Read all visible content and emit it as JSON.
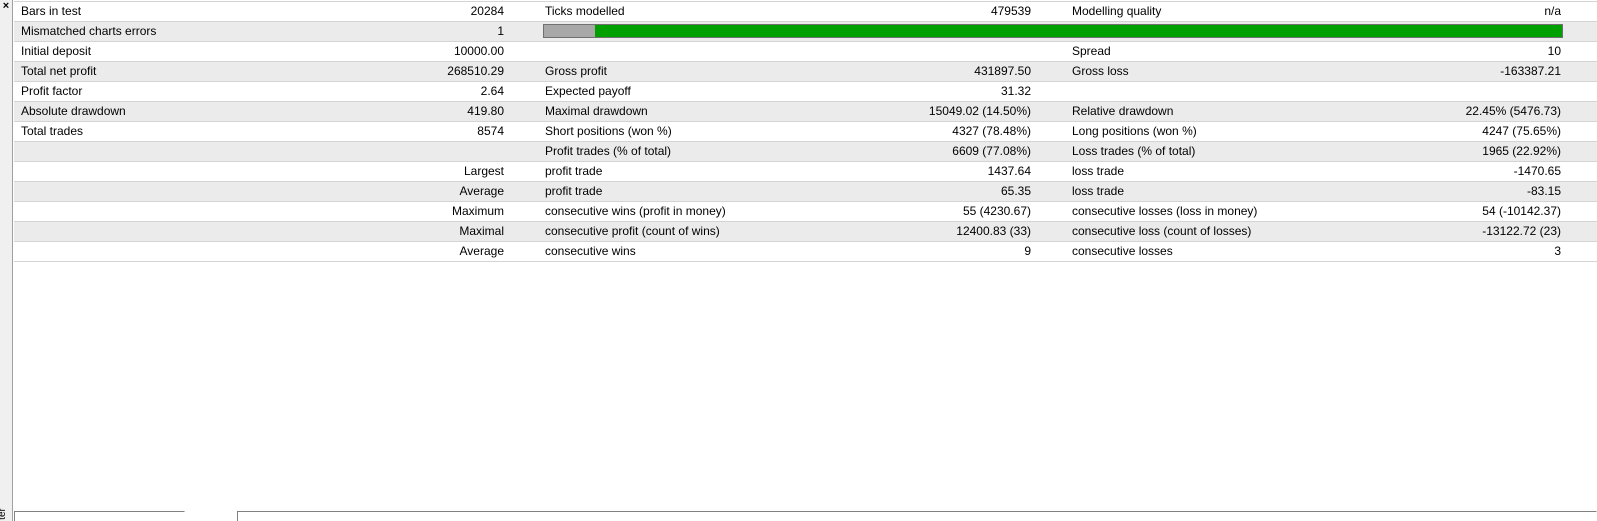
{
  "window": {
    "close_glyph": "×",
    "side_label": "ter"
  },
  "colors": {
    "bar_green": "#00a000",
    "bar_grey": "#a8a8a8",
    "row_alt": "#ebebeb"
  },
  "progress": {
    "grey_fraction": 0.05
  },
  "rows": [
    {
      "c1": "Bars in test",
      "v1": "20284",
      "c3": "Ticks modelled",
      "v3": "479539",
      "c5": "Modelling quality",
      "v5": "n/a"
    },
    {
      "c1": "Mismatched charts errors",
      "v1": "1"
    },
    {
      "c1": "Initial deposit",
      "v1": "10000.00",
      "c5": "Spread",
      "v5": "10"
    },
    {
      "c1": "Total net profit",
      "v1": "268510.29",
      "c3": "Gross profit",
      "v3": "431897.50",
      "c5": "Gross loss",
      "v5": "-163387.21"
    },
    {
      "c1": "Profit factor",
      "v1": "2.64",
      "c3": "Expected payoff",
      "v3": "31.32"
    },
    {
      "c1": "Absolute drawdown",
      "v1": "419.80",
      "c3": "Maximal drawdown",
      "v3": "15049.02 (14.50%)",
      "c5": "Relative drawdown",
      "v5": "22.45% (5476.73)"
    },
    {
      "c1": "Total trades",
      "v1": "8574",
      "c3": "Short positions (won %)",
      "v3": "4327 (78.48%)",
      "c5": "Long positions (won %)",
      "v5": "4247 (75.65%)"
    },
    {
      "c3": "Profit trades (% of total)",
      "v3": "6609 (77.08%)",
      "c5": "Loss trades (% of total)",
      "v5": "1965 (22.92%)"
    },
    {
      "c1r": "Largest",
      "c3": "profit trade",
      "v3": "1437.64",
      "c5": "loss trade",
      "v5": "-1470.65"
    },
    {
      "c1r": "Average",
      "c3": "profit trade",
      "v3": "65.35",
      "c5": "loss trade",
      "v5": "-83.15"
    },
    {
      "c1r": "Maximum",
      "c3": "consecutive wins (profit in money)",
      "v3": "55 (4230.67)",
      "c5": "consecutive losses (loss in money)",
      "v5": "54 (-10142.37)"
    },
    {
      "c1r": "Maximal",
      "c3": "consecutive profit (count of wins)",
      "v3": "12400.83 (33)",
      "c5": "consecutive loss (count of losses)",
      "v5": "-13122.72 (23)"
    },
    {
      "c1r": "Average",
      "c3": "consecutive wins",
      "v3": "9",
      "c5": "consecutive losses",
      "v5": "3"
    }
  ]
}
